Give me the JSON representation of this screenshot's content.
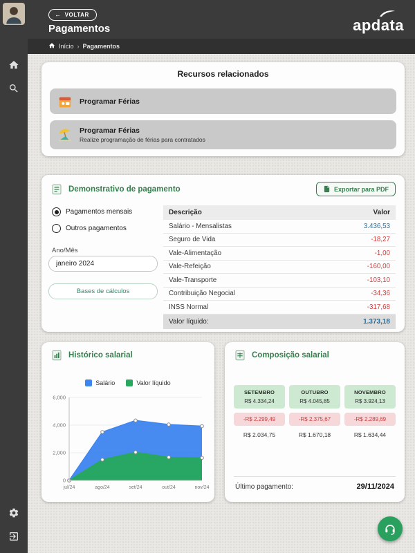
{
  "header": {
    "back_label": "VOLTAR",
    "title": "Pagamentos",
    "breadcrumb_home": "Início",
    "breadcrumb_current": "Pagamentos",
    "logo_text": "apdata"
  },
  "related": {
    "title": "Recursos relacionados",
    "items": [
      {
        "label": "Programar Férias",
        "description": ""
      },
      {
        "label": "Programar Férias",
        "description": "Realize programação de férias para contratados"
      }
    ]
  },
  "statement": {
    "title": "Demonstrativo de pagamento",
    "export_label": "Exportar para PDF",
    "radios": [
      {
        "label": "Pagamentos mensais",
        "checked": true
      },
      {
        "label": "Outros pagamentos",
        "checked": false
      }
    ],
    "period_label": "Ano/Mês",
    "period_value": "janeiro 2024",
    "bases_button": "Bases de cálculos",
    "table": {
      "col_desc": "Descrição",
      "col_value": "Valor",
      "rows": [
        {
          "desc": "Salário - Mensalistas",
          "value": "3.436,53"
        },
        {
          "desc": "Seguro de Vida",
          "value": "-18,27"
        },
        {
          "desc": "Vale-Alimentação",
          "value": "-1,00"
        },
        {
          "desc": "Vale-Refeição",
          "value": "-160,00"
        },
        {
          "desc": "Vale-Transporte",
          "value": "-103,10"
        },
        {
          "desc": "Contribuição Negocial",
          "value": "-34,36"
        },
        {
          "desc": "INSS Normal",
          "value": "-317,68"
        }
      ],
      "footer_label": "Valor líquido:",
      "footer_value": "1.373,18"
    }
  },
  "history": {
    "title": "Histórico salarial"
  },
  "chart_data": {
    "type": "area",
    "title": "Histórico salarial",
    "x": [
      "jul/24",
      "ago/24",
      "set/24",
      "out/24",
      "nov/24"
    ],
    "series": [
      {
        "name": "Salário",
        "color": "#3d85f0",
        "values": [
          0,
          3500,
          4334.24,
          4045.85,
          3924.13
        ]
      },
      {
        "name": "Valor líquido",
        "color": "#27a85c",
        "values": [
          0,
          1500,
          2034.75,
          1670.18,
          1634.44
        ]
      }
    ],
    "ylim": [
      0,
      6000
    ],
    "yticks": [
      "0",
      "2,000",
      "4,000",
      "6,000"
    ],
    "legend_position": "top",
    "grid": false
  },
  "composition": {
    "title": "Composição salarial",
    "months": [
      {
        "name": "SETEMBRO",
        "gross": "R$ 4.334,24",
        "deduction": "-R$ 2.299,49",
        "net": "R$ 2.034,75"
      },
      {
        "name": "OUTUBRO",
        "gross": "R$ 4.045,85",
        "deduction": "-R$ 2.375,67",
        "net": "R$ 1.670,18"
      },
      {
        "name": "NOVEMBRO",
        "gross": "R$ 3.924,13",
        "deduction": "-R$ 2.289,69",
        "net": "R$ 1.634,44"
      }
    ],
    "last_payment_label": "Último pagamento:",
    "last_payment_value": "29/11/2024"
  },
  "colors": {
    "accent_green": "#35804c",
    "value_positive": "#2a6f9e",
    "value_negative": "#d23c3c",
    "chart_blue": "#3d85f0",
    "chart_green": "#27a85c",
    "fab_green": "#2aa05e"
  }
}
